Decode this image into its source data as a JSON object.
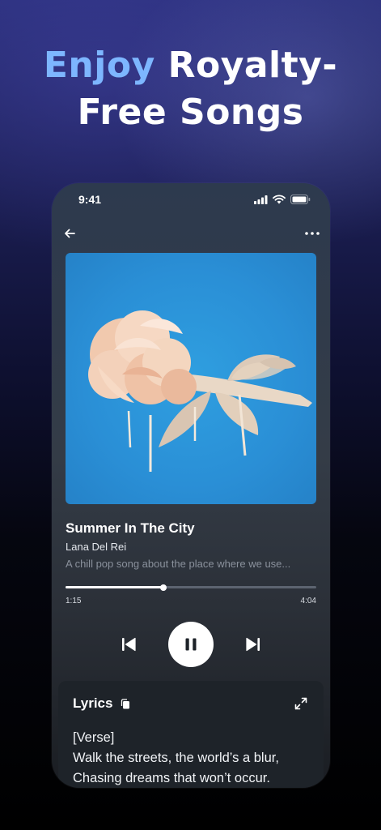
{
  "headline": {
    "accent": "Enjoy",
    "rest_line1": "Royalty-",
    "line2": "Free Songs"
  },
  "status_bar": {
    "time": "9:41"
  },
  "track": {
    "title": "Summer In The City",
    "artist": "Lana Del Rei",
    "description": "A chill pop song about the place where we use..."
  },
  "playback": {
    "elapsed": "1:15",
    "total": "4:04",
    "progress": 0.39,
    "state": "playing"
  },
  "lyrics": {
    "title": "Lyrics",
    "lines": [
      "[Verse]",
      "Walk the streets, the world’s a blur,",
      "Chasing dreams that won’t occur."
    ]
  },
  "icons": {
    "back": "back-arrow-icon",
    "more": "more-dots-icon",
    "copy": "copy-icon",
    "expand": "expand-icon",
    "prev": "skip-previous-icon",
    "pause": "pause-icon",
    "next": "skip-next-icon",
    "signal": "cellular-signal-icon",
    "wifi": "wifi-icon",
    "battery": "battery-icon"
  },
  "colors": {
    "accent": "#7db6ff",
    "cover_bg": "#2a8fd6"
  }
}
